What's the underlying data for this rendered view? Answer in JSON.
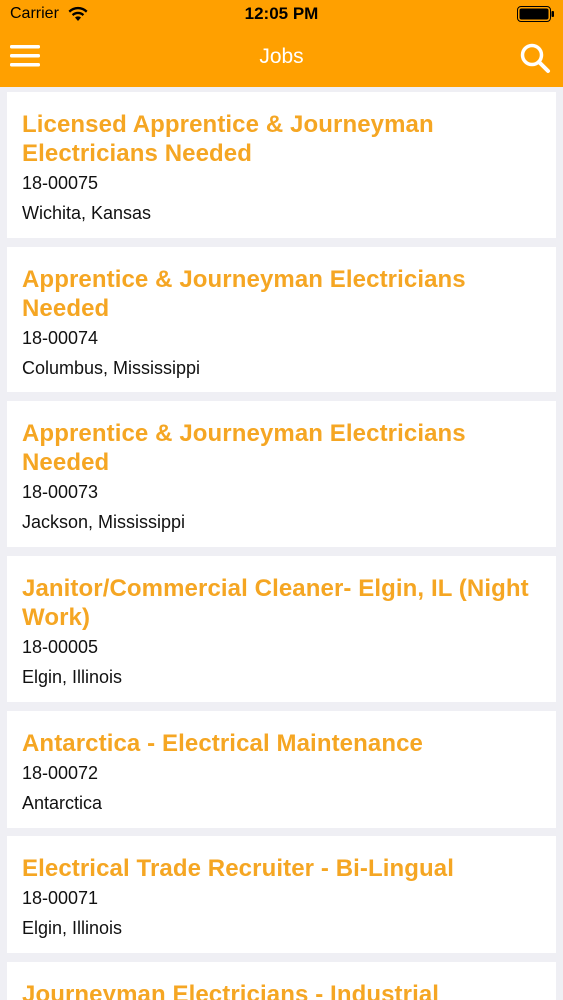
{
  "status_bar": {
    "carrier": "Carrier",
    "time": "12:05 PM"
  },
  "nav": {
    "title": "Jobs",
    "left_icon": "hamburger-menu-icon",
    "right_icon": "search-icon",
    "background_color": "#ffa000"
  },
  "jobs": [
    {
      "title": "Licensed Apprentice & Journeyman Electricians Needed",
      "id": "18-00075",
      "location": "Wichita, Kansas"
    },
    {
      "title": "Apprentice & Journeyman Electricians Needed",
      "id": "18-00074",
      "location": "Columbus, Mississippi"
    },
    {
      "title": "Apprentice & Journeyman Electricians Needed",
      "id": "18-00073",
      "location": "Jackson, Mississippi"
    },
    {
      "title": "Janitor/Commercial Cleaner- Elgin, IL (Night Work)",
      "id": "18-00005",
      "location": "Elgin, Illinois"
    },
    {
      "title": "Antarctica - Electrical Maintenance",
      "id": "18-00072",
      "location": "Antarctica"
    },
    {
      "title": "Electrical Trade Recruiter - Bi-Lingual",
      "id": "18-00071",
      "location": "Elgin, Illinois"
    },
    {
      "title": "Journeyman Electricians - Industrial",
      "id": "",
      "location": ""
    }
  ],
  "colors": {
    "accent": "#ffa000",
    "job_title": "#f5a623",
    "list_background": "#efeff4"
  }
}
